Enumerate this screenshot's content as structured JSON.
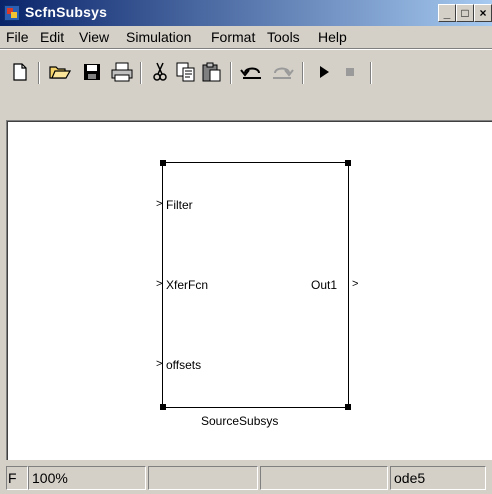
{
  "window": {
    "title": "ScfnSubsys",
    "buttons": {
      "minimize": "_",
      "maximize": "□",
      "close": "×"
    }
  },
  "menu": [
    "File",
    "Edit",
    "View",
    "Simulation",
    "Format",
    "Tools",
    "Help"
  ],
  "toolbar": {
    "icons": [
      "new-icon",
      "open-icon",
      "save-icon",
      "print-icon",
      "cut-icon",
      "copy-icon",
      "paste-icon",
      "undo-icon",
      "redo-icon",
      "play-icon",
      "stop-icon"
    ]
  },
  "block": {
    "name": "SourceSubsys",
    "inputs": [
      "Filter",
      "XferFcn",
      "offsets"
    ],
    "outputs": [
      "Out1"
    ]
  },
  "status": {
    "left": "F",
    "zoom": "100%",
    "solver": "ode5"
  }
}
